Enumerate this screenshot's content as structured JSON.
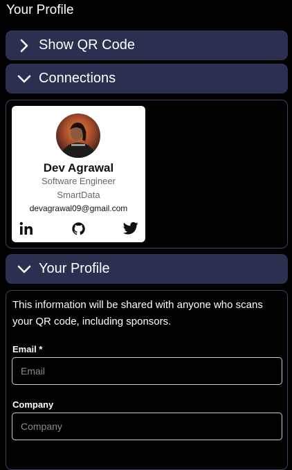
{
  "page": {
    "title": "Your Profile"
  },
  "accordions": {
    "qr": {
      "label": "Show QR Code",
      "expanded": false
    },
    "connections": {
      "label": "Connections",
      "expanded": true
    },
    "profile": {
      "label": "Your Profile",
      "expanded": true
    }
  },
  "connection_card": {
    "name": "Dev Agrawal",
    "role": "Software Engineer",
    "company": "SmartData",
    "email": "devagrawal09@gmail.com",
    "socials": [
      "linkedin-icon",
      "github-icon",
      "twitter-icon"
    ]
  },
  "profile_form": {
    "info": "This information will be shared with anyone who scans your QR code, including sponsors.",
    "email": {
      "label": "Email *",
      "placeholder": "Email",
      "value": ""
    },
    "company": {
      "label": "Company",
      "placeholder": "Company",
      "value": ""
    }
  },
  "colors": {
    "background": "#000000",
    "accordion": "#2b3050",
    "panel_border": "#3e4260",
    "card": "#ffffff"
  }
}
